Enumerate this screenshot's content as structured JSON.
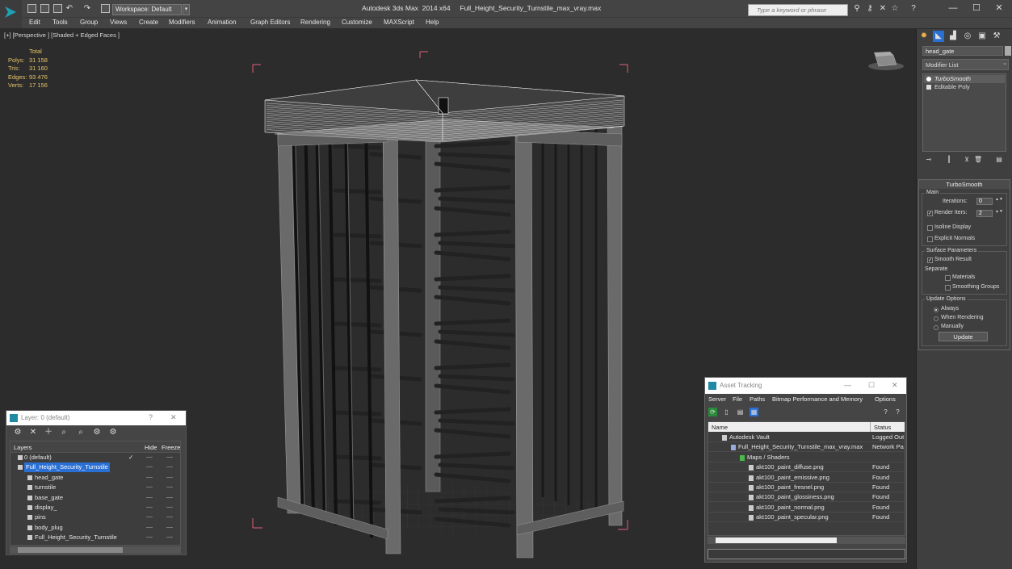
{
  "titlebar": {
    "workspace": "Workspace: Default",
    "app_title": "Autodesk 3ds Max  2014 x64",
    "file_title": "Full_Height_Security_Turnstile_max_vray.max",
    "search_placeholder": "Type a keyword or phrase"
  },
  "menu": [
    "Edit",
    "Tools",
    "Group",
    "Views",
    "Create",
    "Modifiers",
    "Animation",
    "Graph Editors",
    "Rendering",
    "Customize",
    "MAXScript",
    "Help"
  ],
  "viewport": {
    "label": "[+] [Perspective ] [Shaded + Edged Faces ]",
    "stats": {
      "header": "Total",
      "rows": [
        {
          "key": "Polys:",
          "value": "31 158"
        },
        {
          "key": "Tris:",
          "value": "31 160"
        },
        {
          "key": "Edges:",
          "value": "93 476"
        },
        {
          "key": "Verts:",
          "value": "17 156"
        }
      ]
    }
  },
  "command_panel": {
    "object_name": "head_gate",
    "modifier_list": "Modifier List",
    "stack": [
      "TurboSmooth",
      "Editable Poly"
    ],
    "rollout_title": "TurboSmooth",
    "main_group": "Main",
    "iterations_label": "Iterations:",
    "iterations_value": "0",
    "render_iters_label": "Render Iters:",
    "render_iters_value": "2",
    "render_iters_checked": true,
    "isoline_label": "Isoline Display",
    "explicit_label": "Explicit Normals",
    "surface_group": "Surface Parameters",
    "smooth_result_label": "Smooth Result",
    "separate_label": "Separate",
    "materials_label": "Materials",
    "smoothing_label": "Smoothing Groups",
    "update_group": "Update Options",
    "always_label": "Always",
    "when_rendering_label": "When Rendering",
    "manually_label": "Manually",
    "update_button": "Update"
  },
  "layers_panel": {
    "title": "Layer: 0 (default)",
    "help": "?",
    "close": "✕",
    "col_layers": "Layers",
    "col_hide": "Hide",
    "col_freeze": "Freeze",
    "rows": [
      {
        "name": "0 (default)",
        "indent": 0,
        "selected": false
      },
      {
        "name": "Full_Height_Security_Turnstile",
        "indent": 0,
        "selected": true
      },
      {
        "name": "head_gate",
        "indent": 1,
        "selected": false
      },
      {
        "name": "turnstile",
        "indent": 1,
        "selected": false
      },
      {
        "name": "base_gate",
        "indent": 1,
        "selected": false
      },
      {
        "name": "display_",
        "indent": 1,
        "selected": false
      },
      {
        "name": "pins",
        "indent": 1,
        "selected": false
      },
      {
        "name": "body_plug",
        "indent": 1,
        "selected": false
      },
      {
        "name": "Full_Height_Security_Turnstile",
        "indent": 1,
        "selected": false
      }
    ]
  },
  "asset_tracking": {
    "title": "Asset Tracking",
    "menu": [
      "Server",
      "File",
      "Paths",
      "Bitmap Performance and Memory",
      "Options"
    ],
    "col_name": "Name",
    "col_status": "Status",
    "rows": [
      {
        "name": "Autodesk Vault",
        "status": "Logged Out",
        "indent": 1
      },
      {
        "name": "Full_Height_Security_Turnstile_max_vray.max",
        "status": "Network Pa",
        "indent": 2
      },
      {
        "name": "Maps / Shaders",
        "status": "",
        "indent": 3
      },
      {
        "name": "akt100_paint_diffuse.png",
        "status": "Found",
        "indent": 4
      },
      {
        "name": "akt100_paint_emissive.png",
        "status": "Found",
        "indent": 4
      },
      {
        "name": "akt100_paint_fresnel.png",
        "status": "Found",
        "indent": 4
      },
      {
        "name": "akt100_paint_glossiness.png",
        "status": "Found",
        "indent": 4
      },
      {
        "name": "akt100_paint_normal.png",
        "status": "Found",
        "indent": 4
      },
      {
        "name": "akt100_paint_specular.png",
        "status": "Found",
        "indent": 4
      }
    ]
  },
  "colors": {
    "stats_text": "#e8c46a",
    "selection": "#2a6fd4",
    "bbox_brackets": "#e0607a"
  }
}
